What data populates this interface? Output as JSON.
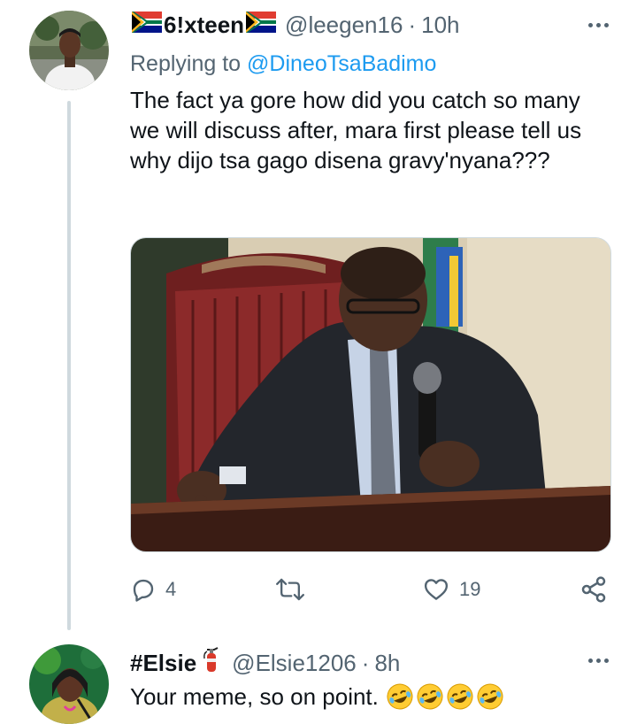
{
  "tweet1": {
    "display_name": "6!xteen",
    "handle": "@leegen16",
    "separator": "·",
    "time": "10h",
    "replying_to_label": "Replying to",
    "replying_to_handle": "@DineoTsaBadimo",
    "text": "The fact ya gore how did you catch so many we will discuss after, mara first please tell us why dijo tsa gago disena gravy'nyana???",
    "actions": {
      "reply_count": "4",
      "retweet_count": "",
      "like_count": "19"
    }
  },
  "tweet2": {
    "display_name": "#Elsie",
    "handle": "@Elsie1206",
    "separator": "·",
    "time": "8h",
    "text": "Your meme, so on point.",
    "emoji_count": 4
  },
  "colors": {
    "text_primary": "#0f1419",
    "text_secondary": "#536471",
    "link": "#1d9bf0",
    "thread_line": "#cfd9de"
  },
  "icons": [
    "more-icon",
    "reply-icon",
    "retweet-icon",
    "like-icon",
    "share-icon",
    "sa-flag-icon",
    "fire-extinguisher-icon",
    "rofl-emoji"
  ]
}
